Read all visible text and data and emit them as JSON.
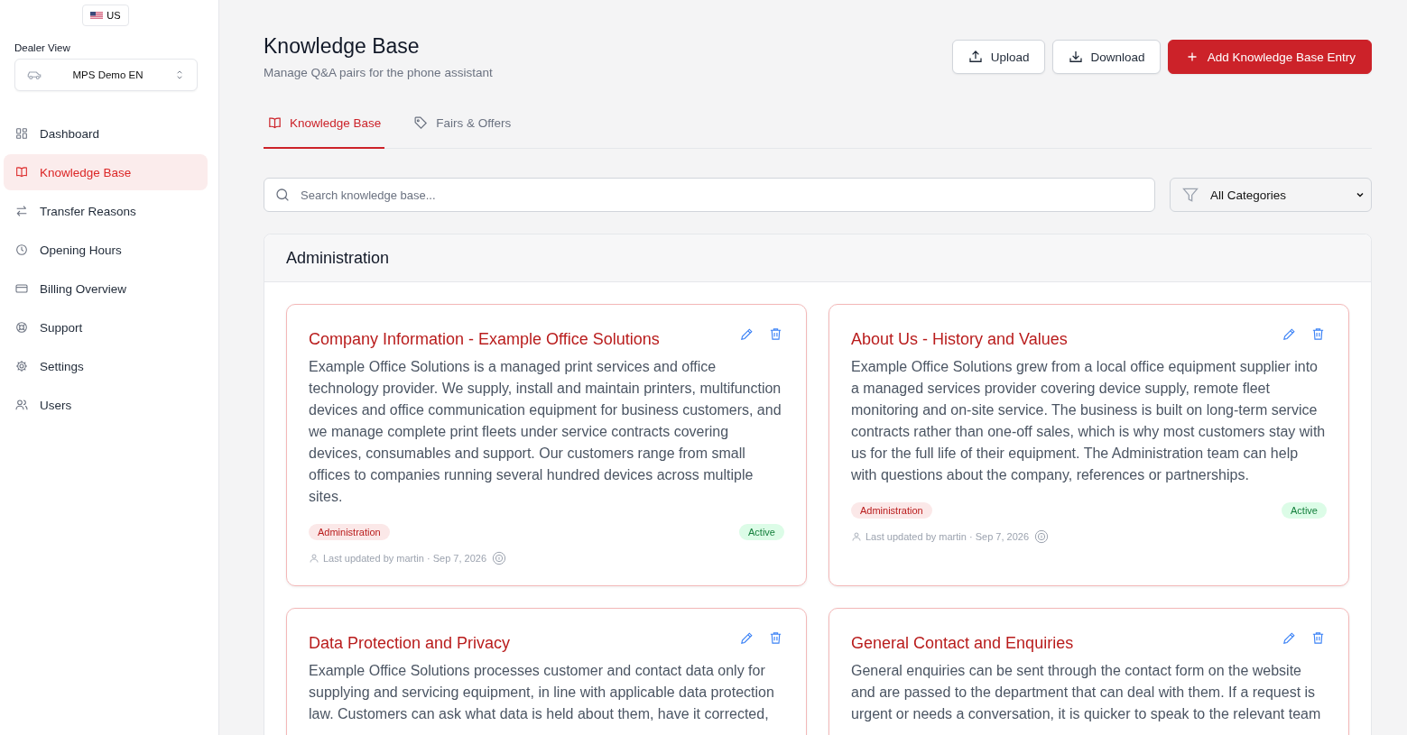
{
  "flag": {
    "label": "US"
  },
  "dealer_view": {
    "label": "Dealer View",
    "value": "MPS Demo EN"
  },
  "nav": [
    {
      "label": "Dashboard",
      "kind": "grid",
      "selected": false
    },
    {
      "label": "Knowledge Base",
      "kind": "book",
      "selected": true
    },
    {
      "label": "Transfer Reasons",
      "kind": "arrows",
      "selected": false
    },
    {
      "label": "Opening Hours",
      "kind": "clock",
      "selected": false
    },
    {
      "label": "Billing Overview",
      "kind": "card",
      "selected": false
    },
    {
      "label": "Support",
      "kind": "lifebuoy",
      "selected": false
    },
    {
      "label": "Settings",
      "kind": "gear",
      "selected": false
    },
    {
      "label": "Users",
      "kind": "users",
      "selected": false
    }
  ],
  "header": {
    "title": "Knowledge Base",
    "subtitle": "Manage Q&A pairs for the phone assistant"
  },
  "actions": [
    {
      "label": "Upload",
      "kind": "upload"
    },
    {
      "label": "Download",
      "kind": "download"
    },
    {
      "label": "Add Knowledge Base Entry",
      "kind": "add"
    }
  ],
  "tabs": [
    {
      "label": "Knowledge Base",
      "kind": "book",
      "selected": true
    },
    {
      "label": "Fairs & Offers",
      "kind": "tag",
      "selected": false
    }
  ],
  "search": {
    "placeholder": "Search knowledge base..."
  },
  "category_filter": {
    "value": "All Categories"
  },
  "sections": [
    {
      "title": "Administration",
      "entries": [
        {
          "title": "Company Information - Example Office Solutions",
          "text": "Example Office Solutions is a managed print services and office technology provider. We supply, install and maintain printers, multifunction devices and office communication equipment for business customers, and we manage complete print fleets under service contracts covering devices, consumables and support. Our customers range from small offices to companies running several hundred devices across multiple sites.",
          "category": "Administration",
          "status": {
            "label": "Active",
            "active": true
          },
          "updated": "Last updated by martin · Sep 7, 2026"
        },
        {
          "title": "About Us - History and Values",
          "text": "Example Office Solutions grew from a local office equipment supplier into a managed services provider covering device supply, remote fleet monitoring and on-site service. The business is built on long-term service contracts rather than one-off sales, which is why most customers stay with us for the full life of their equipment. The Administration team can help with questions about the company, references or partnerships.",
          "category": "Administration",
          "status": {
            "label": "Active",
            "active": true
          },
          "updated": "Last updated by martin · Sep 7, 2026"
        },
        {
          "title": "Data Protection and Privacy",
          "text": "Example Office Solutions processes customer and contact data only for supplying and servicing equipment, in line with applicable data protection law. Customers can ask what data is held about them, have it corrected,"
        },
        {
          "title": "General Contact and Enquiries",
          "text": "General enquiries can be sent through the contact form on the website and are passed to the department that can deal with them. If a request is urgent or needs a conversation, it is quicker to speak to the relevant team"
        }
      ]
    }
  ]
}
